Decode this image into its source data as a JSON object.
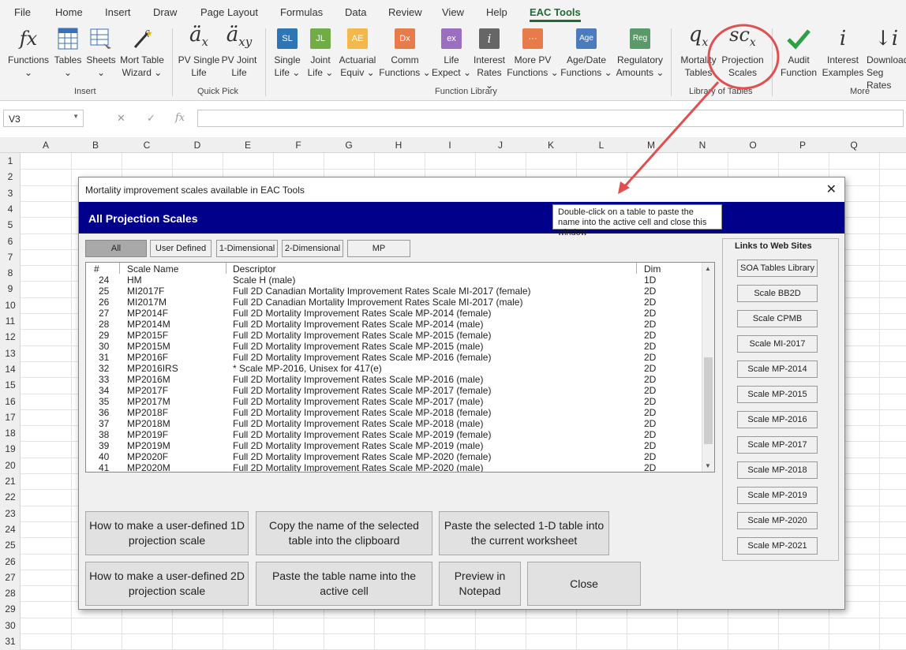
{
  "menu": {
    "tabs": [
      "File",
      "Home",
      "Insert",
      "Draw",
      "Page Layout",
      "Formulas",
      "Data",
      "Review",
      "View",
      "Help",
      "EAC Tools"
    ]
  },
  "ribbon": {
    "buttons": [
      {
        "l1": "Functions",
        "l2": "⌄"
      },
      {
        "l1": "Tables",
        "l2": "⌄"
      },
      {
        "l1": "Sheets",
        "l2": "⌄"
      },
      {
        "l1": "Mort Table",
        "l2": "Wizard ⌄"
      },
      {
        "l1": "PV Single",
        "l2": "Life"
      },
      {
        "l1": "PV Joint",
        "l2": "Life"
      },
      {
        "l1": "Single",
        "l2": "Life ⌄"
      },
      {
        "l1": "Joint",
        "l2": "Life ⌄"
      },
      {
        "l1": "Actuarial",
        "l2": "Equiv ⌄"
      },
      {
        "l1": "Comm",
        "l2": "Functions ⌄"
      },
      {
        "l1": "Life",
        "l2": "Expect ⌄"
      },
      {
        "l1": "Interest",
        "l2": "Rates ⌄"
      },
      {
        "l1": "More PV",
        "l2": "Functions ⌄"
      },
      {
        "l1": "Age/Date",
        "l2": "Functions ⌄"
      },
      {
        "l1": "Regulatory",
        "l2": "Amounts ⌄"
      },
      {
        "l1": "Mortality",
        "l2": "Tables"
      },
      {
        "l1": "Projection",
        "l2": "Scales"
      },
      {
        "l1": "Audit",
        "l2": "Function"
      },
      {
        "l1": "Interest",
        "l2": "Examples"
      },
      {
        "l1": "Download",
        "l2": "Seg Rates"
      }
    ],
    "icons": {
      "sl": "SL",
      "jl": "JL",
      "ae": "AE",
      "dx": "Dx",
      "ex": "ex",
      "i": "i",
      "age": "Age",
      "reg": "Reg",
      "dots": "···"
    },
    "groups": [
      "Insert",
      "Quick Pick",
      "Function Library",
      "Library of Tables",
      "More"
    ]
  },
  "formula_bar": {
    "name_box": "V3",
    "fx": "fx",
    "value": ""
  },
  "columns": [
    "A",
    "B",
    "C",
    "D",
    "E",
    "F",
    "G",
    "H",
    "I",
    "J",
    "K",
    "L",
    "M",
    "N",
    "O",
    "P",
    "Q"
  ],
  "rows": [
    "1",
    "2",
    "3",
    "4",
    "5",
    "6",
    "7",
    "8",
    "9",
    "10",
    "11",
    "12",
    "13",
    "14",
    "15",
    "16",
    "17",
    "18",
    "19",
    "20",
    "21",
    "22",
    "23",
    "24",
    "25",
    "26",
    "27",
    "28",
    "29",
    "30",
    "31"
  ],
  "dialog": {
    "title": "Mortality improvement scales available in EAC Tools",
    "close": "✕",
    "banner_title": "All Projection Scales",
    "tooltip": "Double-click on a table to paste the name into the active cell and close this window",
    "filters": [
      "All",
      "User Defined",
      "1-Dimensional",
      "2-Dimensional",
      "MP"
    ],
    "headers": {
      "num": "#",
      "name": "Scale Name",
      "desc": "Descriptor",
      "dim": "Dim"
    },
    "rows": [
      {
        "n": "24",
        "name": "HM",
        "desc": "Scale H (male)",
        "dim": "1D"
      },
      {
        "n": "25",
        "name": "MI2017F",
        "desc": "Full 2D Canadian Mortality Improvement Rates Scale MI-2017 (female)",
        "dim": "2D"
      },
      {
        "n": "26",
        "name": "MI2017M",
        "desc": "Full 2D Canadian Mortality Improvement Rates Scale MI-2017 (male)",
        "dim": "2D"
      },
      {
        "n": "27",
        "name": "MP2014F",
        "desc": "Full 2D Mortality Improvement Rates Scale MP-2014 (female)",
        "dim": "2D"
      },
      {
        "n": "28",
        "name": "MP2014M",
        "desc": "Full 2D Mortality Improvement Rates Scale MP-2014 (male)",
        "dim": "2D"
      },
      {
        "n": "29",
        "name": "MP2015F",
        "desc": "Full 2D Mortality Improvement Rates Scale MP-2015 (female)",
        "dim": "2D"
      },
      {
        "n": "30",
        "name": "MP2015M",
        "desc": "Full 2D Mortality Improvement Rates Scale MP-2015 (male)",
        "dim": "2D"
      },
      {
        "n": "31",
        "name": "MP2016F",
        "desc": "Full 2D Mortality Improvement Rates Scale MP-2016 (female)",
        "dim": "2D"
      },
      {
        "n": "32",
        "name": "MP2016IRS",
        "desc": "* Scale MP-2016, Unisex for 417(e)",
        "dim": "2D"
      },
      {
        "n": "33",
        "name": "MP2016M",
        "desc": "Full 2D Mortality Improvement Rates Scale MP-2016 (male)",
        "dim": "2D"
      },
      {
        "n": "34",
        "name": "MP2017F",
        "desc": "Full 2D Mortality Improvement Rates Scale MP-2017 (female)",
        "dim": "2D"
      },
      {
        "n": "35",
        "name": "MP2017M",
        "desc": "Full 2D Mortality Improvement Rates Scale MP-2017 (male)",
        "dim": "2D"
      },
      {
        "n": "36",
        "name": "MP2018F",
        "desc": "Full 2D Mortality Improvement Rates Scale MP-2018 (female)",
        "dim": "2D"
      },
      {
        "n": "37",
        "name": "MP2018M",
        "desc": "Full 2D Mortality Improvement Rates Scale MP-2018 (male)",
        "dim": "2D"
      },
      {
        "n": "38",
        "name": "MP2019F",
        "desc": "Full 2D Mortality Improvement Rates Scale MP-2019 (female)",
        "dim": "2D"
      },
      {
        "n": "39",
        "name": "MP2019M",
        "desc": "Full 2D Mortality Improvement Rates Scale MP-2019 (male)",
        "dim": "2D"
      },
      {
        "n": "40",
        "name": "MP2020F",
        "desc": "Full 2D Mortality Improvement Rates Scale MP-2020 (female)",
        "dim": "2D"
      },
      {
        "n": "41",
        "name": "MP2020M",
        "desc": "Full 2D Mortality Improvement Rates Scale MP-2020 (male)",
        "dim": "2D"
      }
    ],
    "buttons": {
      "b1": "How to make a user-defined 1D projection scale",
      "b2": "Copy the name of the selected table into the clipboard",
      "b3": "Paste the selected 1-D table into the current worksheet",
      "b4": "How to make a user-defined 2D projection scale",
      "b5": "Paste the table name into the active cell",
      "b6": "Preview in Notepad",
      "b7": "Close"
    },
    "links_title": "Links to Web Sites",
    "links": [
      "SOA Tables Library",
      "Scale BB2D",
      "Scale CPMB",
      "Scale MI-2017",
      "Scale MP-2014",
      "Scale MP-2015",
      "Scale MP-2016",
      "Scale MP-2017",
      "Scale MP-2018",
      "Scale MP-2019",
      "Scale MP-2020",
      "Scale MP-2021"
    ]
  },
  "colors": {
    "accent": "#1e6b35",
    "banner": "#00008b",
    "callout": "#e05050"
  }
}
